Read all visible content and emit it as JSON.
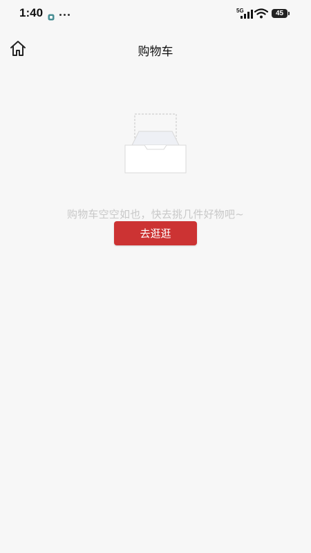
{
  "status_bar": {
    "time": "1:40",
    "network": "5G",
    "battery": "45"
  },
  "header": {
    "title": "购物车",
    "home_icon": "home-icon"
  },
  "empty_state": {
    "illustration_icon": "empty-box-icon",
    "message": "购物车空空如也，快去挑几件好物吧~",
    "button_label": "去逛逛"
  },
  "colors": {
    "background": "#f7f7f7",
    "accent": "#cc3333",
    "muted_text": "#c8c8c8"
  }
}
